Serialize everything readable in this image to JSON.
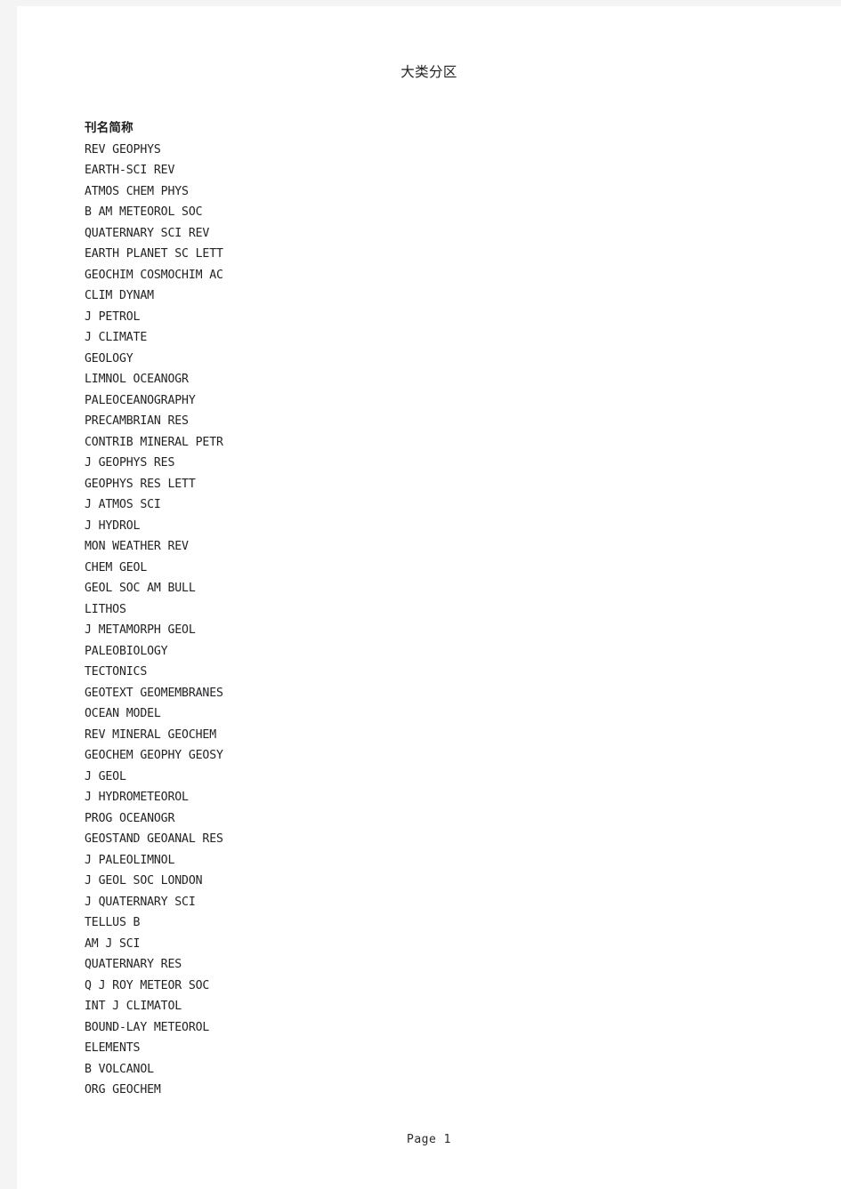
{
  "document": {
    "title": "大类分区",
    "footer_label": "Page 1"
  },
  "journal_list": {
    "column_header": "刊名简称",
    "entries": [
      "REV GEOPHYS",
      "EARTH-SCI REV",
      "ATMOS CHEM PHYS",
      "B AM METEOROL SOC",
      "QUATERNARY SCI REV",
      "EARTH PLANET SC LETT",
      "GEOCHIM COSMOCHIM AC",
      "CLIM DYNAM",
      "J PETROL",
      "J CLIMATE",
      "GEOLOGY",
      "LIMNOL OCEANOGR",
      "PALEOCEANOGRAPHY",
      "PRECAMBRIAN RES",
      "CONTRIB MINERAL PETR",
      "J GEOPHYS RES",
      "GEOPHYS RES LETT",
      "J ATMOS SCI",
      "J HYDROL",
      "MON WEATHER REV",
      "CHEM GEOL",
      "GEOL SOC AM BULL",
      "LITHOS",
      "J METAMORPH GEOL",
      "PALEOBIOLOGY",
      "TECTONICS",
      "GEOTEXT GEOMEMBRANES",
      "OCEAN MODEL",
      "REV MINERAL GEOCHEM",
      "GEOCHEM GEOPHY GEOSY",
      "J GEOL",
      "J HYDROMETEOROL",
      "PROG OCEANOGR",
      "GEOSTAND GEOANAL RES",
      "J PALEOLIMNOL",
      "J GEOL SOC LONDON",
      "J QUATERNARY SCI",
      "TELLUS B",
      "AM J SCI",
      "QUATERNARY RES",
      "Q J ROY METEOR SOC",
      "INT J CLIMATOL",
      "BOUND-LAY METEOROL",
      "ELEMENTS",
      "B VOLCANOL",
      "ORG GEOCHEM"
    ]
  },
  "colors": {
    "page_background": "#ffffff",
    "viewer_backdrop": "#f4f4f5",
    "text": "#232327"
  }
}
